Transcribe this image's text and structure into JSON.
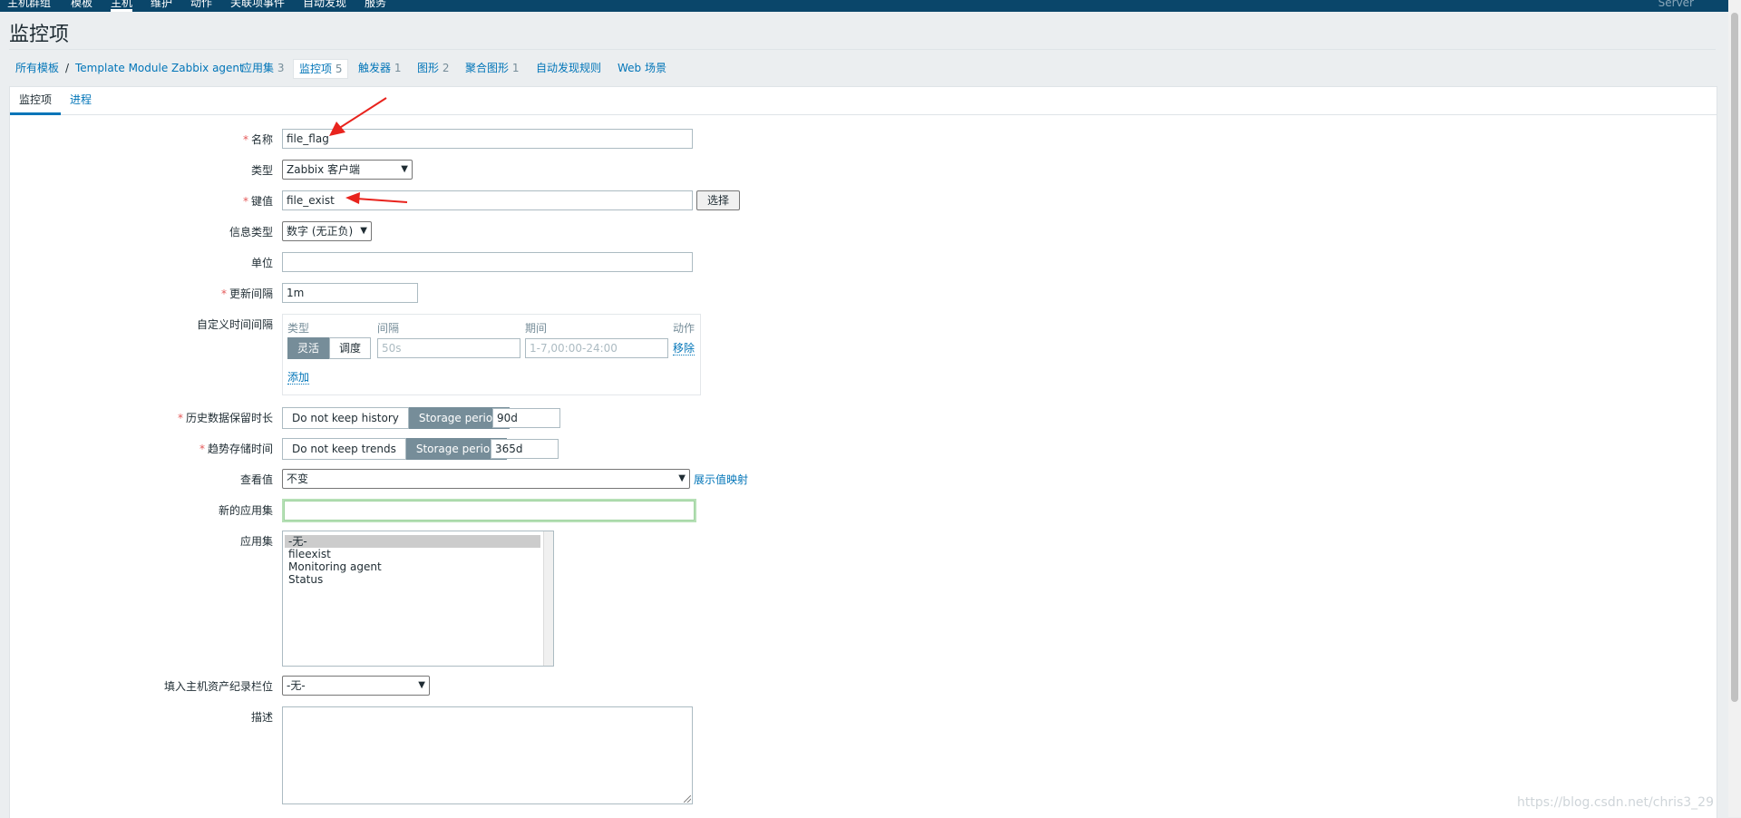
{
  "topnav": {
    "items": [
      "主机群组",
      "模板",
      "主机",
      "维护",
      "动作",
      "关联项事件",
      "自动发现",
      "服务"
    ],
    "active": "主机",
    "user": "Server"
  },
  "page_title": "监控项",
  "breadcrumbs": {
    "all_templates": "所有模板",
    "template": "Template Module Zabbix agent",
    "applications": {
      "label": "应用集",
      "count": "3"
    },
    "items": {
      "label": "监控项",
      "count": "5"
    },
    "triggers": {
      "label": "触发器",
      "count": "1"
    },
    "graphs": {
      "label": "图形",
      "count": "2"
    },
    "screens": {
      "label": "聚合图形",
      "count": "1"
    },
    "discovery": "自动发现规则",
    "web": "Web 场景"
  },
  "tabs": {
    "item": "监控项",
    "process": "进程"
  },
  "form": {
    "name": {
      "label": "名称",
      "value": "file_flag"
    },
    "type": {
      "label": "类型",
      "value": "Zabbix 客户端"
    },
    "key": {
      "label": "键值",
      "value": "file_exist",
      "select_button": "选择"
    },
    "info_type": {
      "label": "信息类型",
      "value": "数字 (无正负)"
    },
    "units": {
      "label": "单位",
      "value": ""
    },
    "update_interval": {
      "label": "更新间隔",
      "value": "1m"
    },
    "custom_intervals": {
      "label": "自定义时间间隔",
      "col_type": "类型",
      "col_interval": "间隔",
      "col_period": "期间",
      "col_action": "动作",
      "flexible": "灵活",
      "scheduling": "调度",
      "interval_placeholder": "50s",
      "period_placeholder": "1-7,00:00-24:00",
      "remove": "移除",
      "add": "添加"
    },
    "history": {
      "label": "历史数据保留时长",
      "opt_off": "Do not keep history",
      "opt_on": "Storage period",
      "value": "90d"
    },
    "trends": {
      "label": "趋势存储时间",
      "opt_off": "Do not keep trends",
      "opt_on": "Storage period",
      "value": "365d"
    },
    "show_value": {
      "label": "查看值",
      "value": "不变",
      "link": "展示值映射"
    },
    "new_application": {
      "label": "新的应用集",
      "value": ""
    },
    "applications": {
      "label": "应用集",
      "options": [
        "-无-",
        "fileexist",
        "Monitoring agent",
        "Status"
      ]
    },
    "inventory": {
      "label": "填入主机资产纪录栏位",
      "value": "-无-"
    },
    "description": {
      "label": "描述"
    }
  },
  "watermark": "https://blog.csdn.net/chris3_29",
  "colors": {
    "header": "#0a466a",
    "link": "#0275b8",
    "required": "#e45959",
    "radio_on": "#768d99",
    "arrow": "#e8231d"
  }
}
